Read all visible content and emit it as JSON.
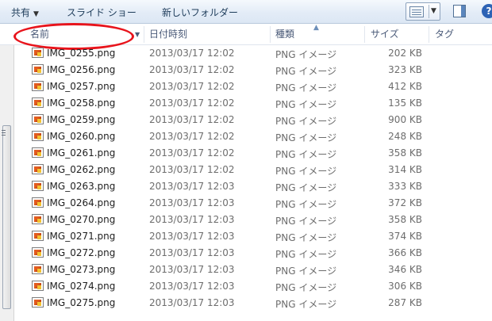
{
  "toolbar": {
    "share_label": "共有",
    "slideshow_label": "スライド ショー",
    "new_folder_label": "新しいフォルダー",
    "help_label": "?"
  },
  "columns": {
    "name": "名前",
    "date": "日付時刻",
    "type": "種類",
    "size": "サイズ",
    "tag": "タグ"
  },
  "files": [
    {
      "name": "IMG_0255.png",
      "date": "2013/03/17 12:02",
      "type": "PNG イメージ",
      "size": "202 KB"
    },
    {
      "name": "IMG_0256.png",
      "date": "2013/03/17 12:02",
      "type": "PNG イメージ",
      "size": "323 KB"
    },
    {
      "name": "IMG_0257.png",
      "date": "2013/03/17 12:02",
      "type": "PNG イメージ",
      "size": "412 KB"
    },
    {
      "name": "IMG_0258.png",
      "date": "2013/03/17 12:02",
      "type": "PNG イメージ",
      "size": "135 KB"
    },
    {
      "name": "IMG_0259.png",
      "date": "2013/03/17 12:02",
      "type": "PNG イメージ",
      "size": "900 KB"
    },
    {
      "name": "IMG_0260.png",
      "date": "2013/03/17 12:02",
      "type": "PNG イメージ",
      "size": "248 KB"
    },
    {
      "name": "IMG_0261.png",
      "date": "2013/03/17 12:02",
      "type": "PNG イメージ",
      "size": "358 KB"
    },
    {
      "name": "IMG_0262.png",
      "date": "2013/03/17 12:02",
      "type": "PNG イメージ",
      "size": "314 KB"
    },
    {
      "name": "IMG_0263.png",
      "date": "2013/03/17 12:03",
      "type": "PNG イメージ",
      "size": "333 KB"
    },
    {
      "name": "IMG_0264.png",
      "date": "2013/03/17 12:03",
      "type": "PNG イメージ",
      "size": "372 KB"
    },
    {
      "name": "IMG_0270.png",
      "date": "2013/03/17 12:03",
      "type": "PNG イメージ",
      "size": "358 KB"
    },
    {
      "name": "IMG_0271.png",
      "date": "2013/03/17 12:03",
      "type": "PNG イメージ",
      "size": "374 KB"
    },
    {
      "name": "IMG_0272.png",
      "date": "2013/03/17 12:03",
      "type": "PNG イメージ",
      "size": "366 KB"
    },
    {
      "name": "IMG_0273.png",
      "date": "2013/03/17 12:03",
      "type": "PNG イメージ",
      "size": "346 KB"
    },
    {
      "name": "IMG_0274.png",
      "date": "2013/03/17 12:03",
      "type": "PNG イメージ",
      "size": "306 KB"
    },
    {
      "name": "IMG_0275.png",
      "date": "2013/03/17 12:03",
      "type": "PNG イメージ",
      "size": "287 KB"
    }
  ],
  "annotation_color": "#e8141c",
  "accent_color": "#2d63b5",
  "icons": {
    "view": "details-view-icon",
    "preview_pane": "preview-pane-icon",
    "help": "help-icon",
    "file": "png-image-file-icon"
  }
}
